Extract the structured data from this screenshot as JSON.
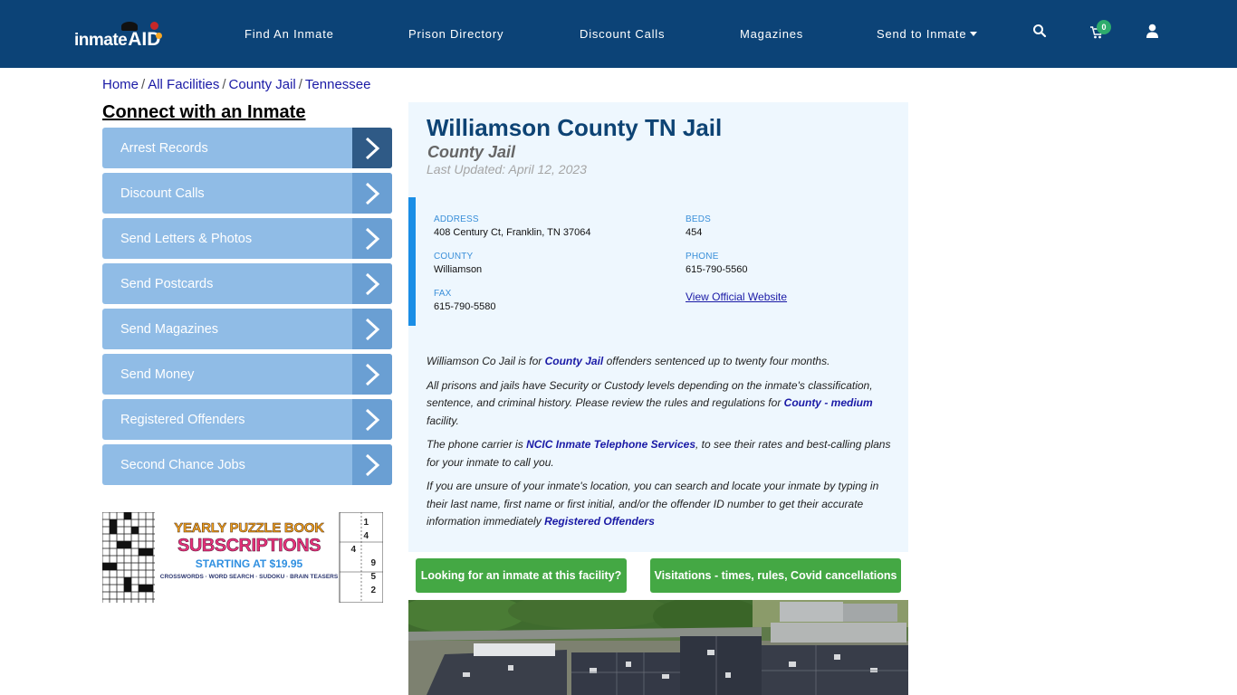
{
  "nav": {
    "logo": {
      "part1": "inmate",
      "part2": "AID"
    },
    "items": [
      {
        "label": "Find An Inmate"
      },
      {
        "label": "Prison Directory"
      },
      {
        "label": "Discount Calls"
      },
      {
        "label": "Magazines"
      },
      {
        "label": "Send to Inmate",
        "has_dropdown": true
      }
    ],
    "icons": [
      "search-icon",
      "cart-icon",
      "user-icon"
    ],
    "cart_count": "0",
    "colors": {
      "bar": "#0c4377",
      "badge": "#2eac6d"
    }
  },
  "breadcrumb": [
    {
      "label": "Home"
    },
    {
      "label": "All Facilities"
    },
    {
      "label": "County Jail"
    },
    {
      "label": "Tennessee"
    }
  ],
  "sidebar": {
    "title": "Connect with an Inmate",
    "items": [
      {
        "label": "Arrest Records"
      },
      {
        "label": "Discount Calls"
      },
      {
        "label": "Send Letters & Photos"
      },
      {
        "label": "Send Postcards"
      },
      {
        "label": "Send Magazines"
      },
      {
        "label": "Send Money"
      },
      {
        "label": "Registered Offenders"
      },
      {
        "label": "Second Chance Jobs"
      }
    ],
    "ad": {
      "line1": "YEARLY PUZZLE BOOK",
      "line2": "SUBSCRIPTIONS",
      "line3": "STARTING AT $19.95",
      "line4": "CROSSWORDS · WORD SEARCH · SUDOKU · BRAIN TEASERS",
      "sudoku_digits": [
        "1",
        "4",
        "4",
        "9",
        "5",
        "2"
      ]
    }
  },
  "facility": {
    "name": "Williamson County TN Jail",
    "type": "County Jail",
    "last_updated": "Last Updated: April 12, 2023",
    "fields": {
      "address": {
        "label": "ADDRESS",
        "value": "408 Century Ct, Franklin, TN 37064"
      },
      "county": {
        "label": "COUNTY",
        "value": "Williamson"
      },
      "fax": {
        "label": "FAX",
        "value": "615-790-5580"
      },
      "beds": {
        "label": "BEDS",
        "value": "454"
      },
      "phone": {
        "label": "PHONE",
        "value": "615-790-5560"
      },
      "website_link": "View Official Website"
    },
    "description": {
      "p1": {
        "pre": "Williamson Co Jail is for ",
        "link": "County Jail",
        "post": " offenders sentenced up to twenty four months."
      },
      "p2": {
        "pre": "All prisons and jails have Security or Custody levels depending on the inmate's classification, sentence, and criminal history. Please review the rules and regulations for ",
        "link": "County - medium",
        "post": " facility."
      },
      "p3": {
        "pre": "The phone carrier is ",
        "link": "NCIC Inmate Telephone Services",
        "post": ", to see their rates and best-calling plans for your inmate to call you."
      },
      "p4": {
        "pre": "If you are unsure of your inmate's location, you can search and locate your inmate by typing in their last name, first name or first initial, and/or the offender ID number to get their accurate information immediately ",
        "link": "Registered Offenders",
        "post": ""
      }
    },
    "buttons": {
      "find_inmate": "Looking for an inmate at this facility?",
      "visitations": "Visitations - times, rules, Covid cancellations"
    }
  }
}
